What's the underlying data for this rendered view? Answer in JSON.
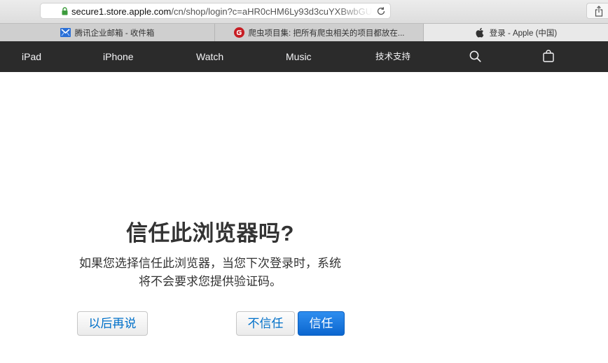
{
  "browser": {
    "url_host": "secure1.store.apple.com",
    "url_path": "/cn/shop/login?c=aHR0cHM6Ly93d3cuYXBwbGUu",
    "tabs": [
      {
        "label": "腾讯企业邮箱 - 收件箱",
        "icon": "tencent-mail-icon",
        "active": false
      },
      {
        "label": "爬虫项目集: 把所有爬虫相关的项目都放在...",
        "icon": "gitee-icon",
        "active": false
      },
      {
        "label": "登录 - Apple (中国)",
        "icon": "apple-logo-icon",
        "active": true
      }
    ]
  },
  "nav": {
    "items": [
      "iPad",
      "iPhone",
      "Watch",
      "Music",
      "技术支持"
    ],
    "icons": [
      "search-icon",
      "shopping-bag-icon"
    ]
  },
  "dialog": {
    "title": "信任此浏览器吗?",
    "body_line1": "如果您选择信任此浏览器，当您下次登录时，系统",
    "body_line2": "将不会要求您提供验证码。",
    "buttons": {
      "later": "以后再说",
      "distrust": "不信任",
      "trust": "信任"
    }
  },
  "colors": {
    "nav_background": "#2b2b2b",
    "link_blue": "#0070c9",
    "primary_button": "#0b66cf",
    "lock_green": "#3c9b3c"
  }
}
